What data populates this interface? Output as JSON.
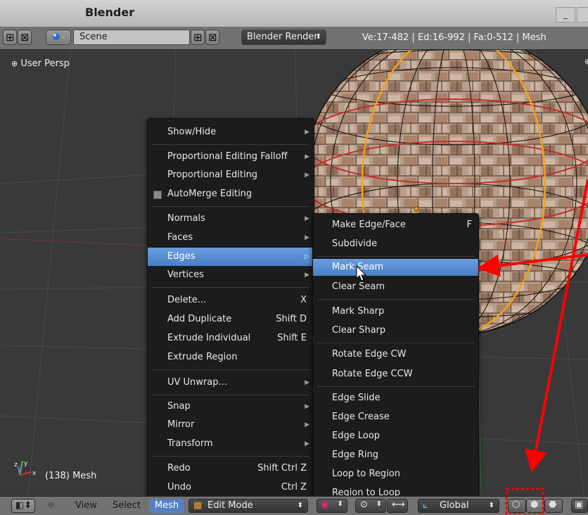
{
  "window": {
    "title": "Blender",
    "minimize_glyph": "_"
  },
  "info_header": {
    "scene_name": "Scene",
    "render_engine": "Blender Render",
    "stats": "Ve:17-482 | Ed:16-992 | Fa:0-512 | Mesh"
  },
  "viewport": {
    "view_label": "User Persp",
    "object_label": "(138) Mesh",
    "axis_labels": {
      "x": "x",
      "y": "y",
      "z": "z"
    }
  },
  "mesh_menu": {
    "items": [
      {
        "label": "Show/Hide",
        "submenu": true
      },
      {
        "label": "Proportional Editing Falloff",
        "submenu": true
      },
      {
        "label": "Proportional Editing",
        "submenu": true
      },
      {
        "label": "AutoMerge Editing",
        "checkbox": true
      },
      {
        "label": "Normals",
        "submenu": true
      },
      {
        "label": "Faces",
        "submenu": true
      },
      {
        "label": "Edges",
        "submenu": true,
        "highlighted": true
      },
      {
        "label": "Vertices",
        "submenu": true
      },
      {
        "label": "Delete...",
        "shortcut": "X"
      },
      {
        "label": "Add Duplicate",
        "shortcut": "Shift D"
      },
      {
        "label": "Extrude Individual",
        "shortcut": "Shift E"
      },
      {
        "label": "Extrude Region"
      },
      {
        "label": "UV Unwrap...",
        "submenu": true
      },
      {
        "label": "Snap",
        "submenu": true
      },
      {
        "label": "Mirror",
        "submenu": true
      },
      {
        "label": "Transform",
        "submenu": true
      },
      {
        "label": "Redo",
        "shortcut": "Shift Ctrl Z"
      },
      {
        "label": "Undo",
        "shortcut": "Ctrl Z"
      }
    ]
  },
  "edges_menu": {
    "items": [
      {
        "label": "Make Edge/Face",
        "shortcut": "F"
      },
      {
        "label": "Subdivide"
      },
      {
        "label": "Mark Seam",
        "highlighted": true
      },
      {
        "label": "Clear Seam"
      },
      {
        "label": "Mark Sharp"
      },
      {
        "label": "Clear Sharp"
      },
      {
        "label": "Rotate Edge CW"
      },
      {
        "label": "Rotate Edge CCW"
      },
      {
        "label": "Edge Slide"
      },
      {
        "label": "Edge Crease"
      },
      {
        "label": "Edge Loop"
      },
      {
        "label": "Edge Ring"
      },
      {
        "label": "Loop to Region"
      },
      {
        "label": "Region to Loop"
      }
    ]
  },
  "bottom_header": {
    "menus": {
      "view": "View",
      "select": "Select",
      "mesh": "Mesh"
    },
    "mode": "Edit Mode",
    "orientation": "Global"
  },
  "icons": [
    "plus-icon",
    "close-icon",
    "scene-icon",
    "chevron-updown-icon",
    "viewport-type-icon",
    "object-mode-icon",
    "pivot-icon",
    "manipulator-icon",
    "orientation-icon",
    "vertex-select-icon",
    "edge-select-icon",
    "face-select-icon",
    "mouse-cursor-icon"
  ],
  "colors": {
    "highlight": "#5680c2",
    "annotation_red": "#ff0000",
    "seam_edge": "#c0302a",
    "selected_edge": "#f2a21c"
  }
}
